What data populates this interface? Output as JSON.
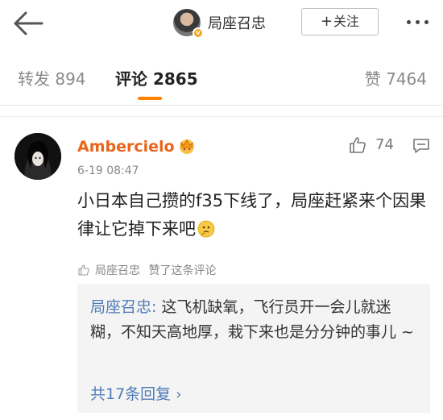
{
  "header": {
    "author_name": "局座召忠",
    "follow_label": "关注",
    "follow_plus": "+"
  },
  "tabs": {
    "repost": "转发 894",
    "comments": "评论 2865",
    "likes": "赞 7464"
  },
  "comment": {
    "username": "Ambercielo",
    "time": "6-19 08:47",
    "like_count": "74",
    "text": "小日本自己攒的f35下线了，局座赶紧来个因果律让它掉下来吧",
    "liked_by_name": "局座召忠",
    "liked_by_suffix": "赞了这条评论",
    "reply": {
      "author": "局座召忠",
      "colon": ": ",
      "text": "这飞机缺氧，飞行员开一会儿就迷糊，不知天高地厚，栽下来也是分分钟的事儿 ~",
      "more": "共17条回复",
      "more_chevron": "›"
    }
  },
  "colors": {
    "accent": "#ff8200",
    "username": "#e8641b",
    "link": "#4f7ab8"
  },
  "icons": [
    "back-arrow-icon",
    "verified-badge-icon",
    "more-dots-icon",
    "crown-icon",
    "thumb-up-icon",
    "reply-icon",
    "thinking-emoji-icon"
  ]
}
